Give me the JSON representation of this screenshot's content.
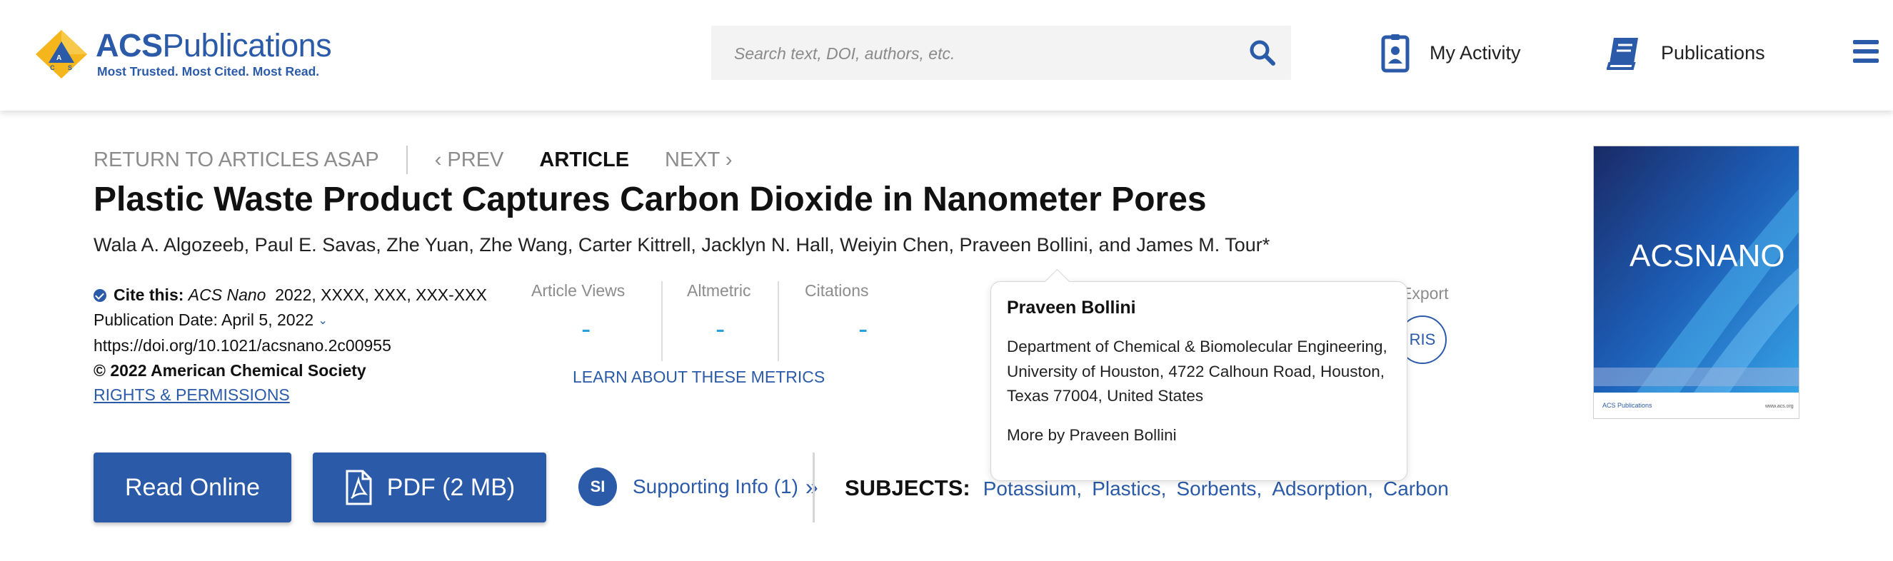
{
  "header": {
    "logo_title_bold": "ACS",
    "logo_title_rest": "Publications",
    "logo_tagline": "Most Trusted. Most Cited. Most Read.",
    "search_placeholder": "Search text, DOI, authors, etc.",
    "my_activity": "My Activity",
    "publications": "Publications",
    "brand_color": "#2b5ba8",
    "logo_accent": "#f5b51c"
  },
  "article_nav": {
    "return": "RETURN TO ARTICLES ASAP",
    "prev": "‹ PREV",
    "current": "ARTICLE",
    "next": "NEXT ›"
  },
  "article": {
    "title": "Plastic Waste Product Captures Carbon Dioxide in Nanometer Pores",
    "authors": "Wala A. Algozeeb, Paul E. Savas, Zhe Yuan, Zhe Wang, Carter Kittrell, Jacklyn N. Hall, Weiyin Chen, Praveen Bollini, and James M. Tour*",
    "cite_label": "Cite this:",
    "journal": "ACS Nano",
    "cite_rest": "2022, XXXX, XXX, XXX-XXX",
    "pub_date": "Publication Date: April 5, 2022",
    "doi": "https://doi.org/10.1021/acsnano.2c00955",
    "copyright": "© 2022 American Chemical Society",
    "rights": "RIGHTS & PERMISSIONS"
  },
  "metrics": {
    "views_label": "Article Views",
    "views_value": "-",
    "altmetric_label": "Altmetric",
    "altmetric_value": "-",
    "citations_label": "Citations",
    "citations_value": "-",
    "learn": "LEARN ABOUT THESE METRICS"
  },
  "export": {
    "label": "Export",
    "ris": "RIS"
  },
  "author_popup": {
    "name": "Praveen Bollini",
    "affiliation": "Department of Chemical & Biomolecular Engineering, University of Houston, 4722 Calhoun Road, Houston, Texas 77004, United States",
    "more_by": "More by Praveen Bollini"
  },
  "cover": {
    "journal_mark": "ACSNANO",
    "footer_logo": "ACS Publications",
    "footer_url": "www.acs.org"
  },
  "actions": {
    "read_online": "Read Online",
    "pdf": "PDF (2 MB)",
    "si_badge": "SI",
    "supporting_info": "Supporting Info (1)",
    "si_chevron": "»"
  },
  "subjects": {
    "label": "SUBJECTS:",
    "items": [
      "Potassium",
      "Plastics",
      "Sorbents",
      "Adsorption",
      "Carbon"
    ],
    "sep": ","
  }
}
